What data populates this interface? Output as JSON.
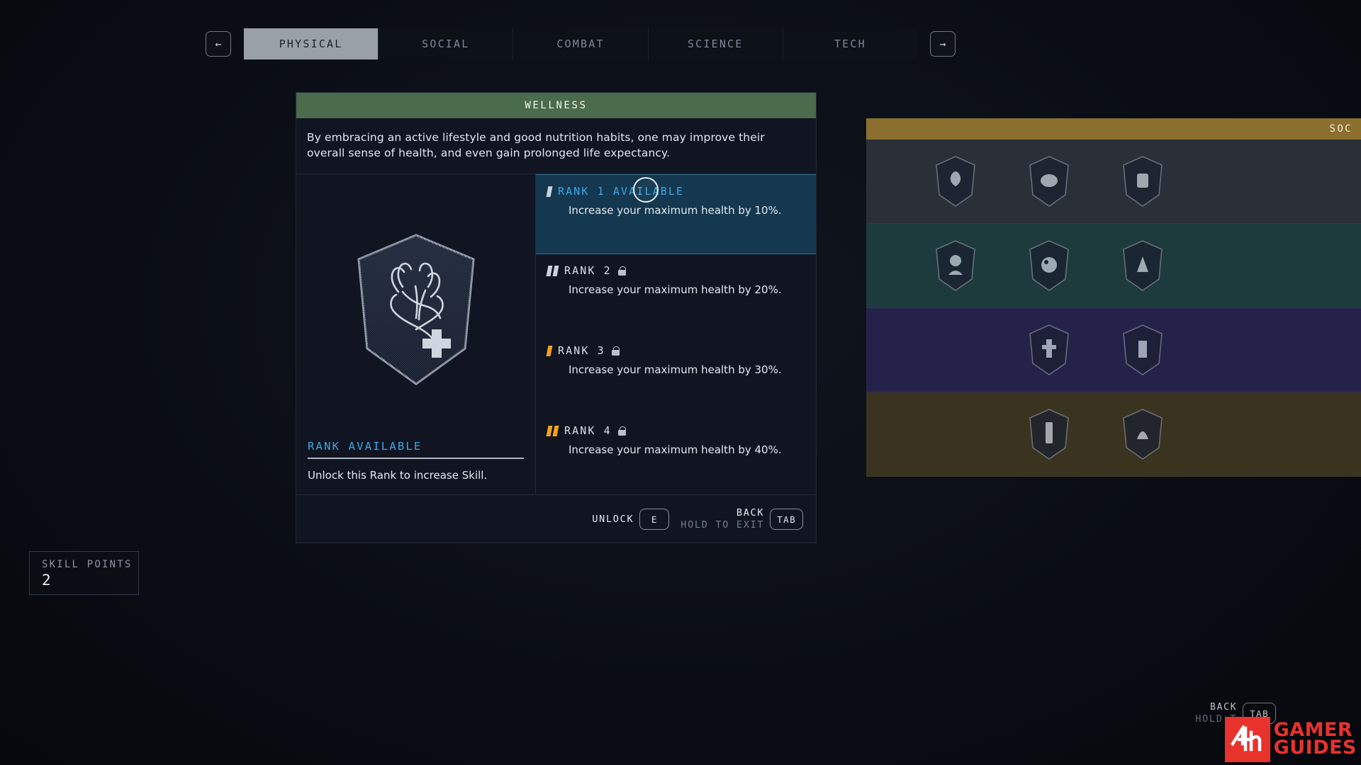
{
  "tabbar": {
    "prev_icon": "←",
    "next_icon": "→",
    "tabs": [
      {
        "label": "PHYSICAL",
        "active": true
      },
      {
        "label": "SOCIAL",
        "active": false
      },
      {
        "label": "COMBAT",
        "active": false
      },
      {
        "label": "SCIENCE",
        "active": false
      },
      {
        "label": "TECH",
        "active": false
      }
    ]
  },
  "skill": {
    "title": "WELLNESS",
    "description": "By embracing an active lifestyle and good nutrition habits, one may improve their overall sense of health, and even gain prolonged life expectancy.",
    "status_label": "RANK AVAILABLE",
    "status_text": "Unlock this Rank to increase Skill.",
    "emblem_icon": "heart-with-medical-cross-icon",
    "ranks": [
      {
        "title": "RANK 1 AVAILABLE",
        "desc": "Increase your maximum health by 10%.",
        "pips": 1,
        "pip_color": "white",
        "locked": false,
        "selected": true
      },
      {
        "title": "RANK 2",
        "desc": "Increase your maximum health by 20%.",
        "pips": 2,
        "pip_color": "white",
        "locked": true,
        "selected": false
      },
      {
        "title": "RANK 3",
        "desc": "Increase your maximum health by 30%.",
        "pips": 1,
        "pip_color": "amber",
        "locked": true,
        "selected": false
      },
      {
        "title": "RANK 4",
        "desc": "Increase your maximum health by 40%.",
        "pips": 2,
        "pip_color": "amber",
        "locked": true,
        "selected": false
      }
    ]
  },
  "footer": {
    "unlock_label": "UNLOCK",
    "unlock_key": "E",
    "back_label": "BACK",
    "back_sub": "HOLD TO EXIT",
    "back_key": "TAB"
  },
  "skill_points": {
    "label": "SKILL POINTS",
    "value": "2"
  },
  "side_panel": {
    "header": "SOC",
    "rows": [
      {
        "cells": 3
      },
      {
        "cells": 3
      },
      {
        "cells": 3
      },
      {
        "cells": 3
      }
    ]
  },
  "hud": {
    "back_label": "BACK",
    "back_sub": "HOLD T",
    "back_key": "TAB"
  },
  "watermark": {
    "line1": "GAMER",
    "line2": "GUIDES",
    "mark": "4th-logo-icon"
  },
  "colors": {
    "accent_cyan": "#3ba7e8",
    "accent_amber": "#f0a21e",
    "header_green": "#4a6b4c",
    "header_gold": "#8a6f2e",
    "panel_bg": "#101521",
    "selected_bg": "#14384f"
  }
}
